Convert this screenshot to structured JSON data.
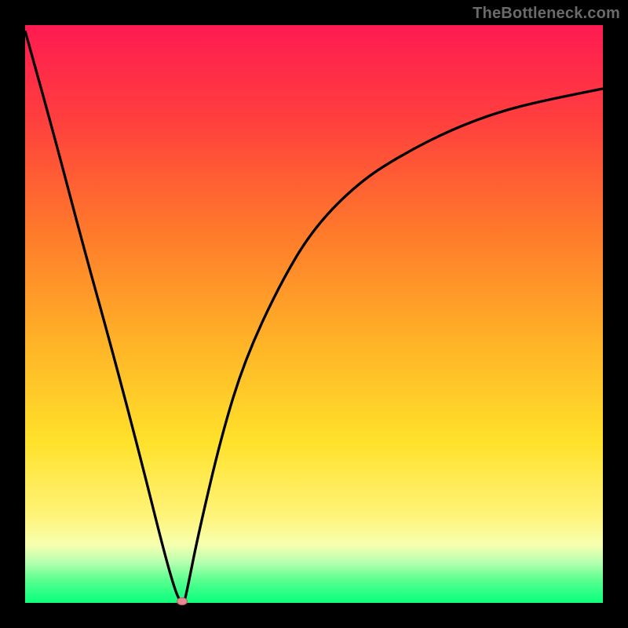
{
  "attribution": "TheBottleneck.com",
  "colors": {
    "curve": "#000000",
    "marker_fill": "#e58a92",
    "marker_stroke": "#b85f68",
    "border": "#000000"
  },
  "chart_data": {
    "type": "line",
    "title": "",
    "xlabel": "",
    "ylabel": "",
    "xlim": [
      0,
      100
    ],
    "ylim": [
      0,
      100
    ],
    "grid": false,
    "legend": false,
    "series": [
      {
        "name": "bottleneck-curve",
        "x": [
          0,
          5,
          10,
          15,
          20,
          24,
          26,
          27,
          27.5,
          28,
          30,
          34,
          38,
          44,
          50,
          58,
          66,
          74,
          82,
          90,
          100
        ],
        "y": [
          99,
          81,
          62,
          44,
          25,
          9,
          2,
          0,
          0,
          2,
          12,
          29,
          42,
          55,
          65,
          73,
          78,
          82,
          85,
          87,
          89
        ]
      }
    ],
    "annotations": [
      {
        "name": "min-marker",
        "x": 27.2,
        "y": 0.3,
        "shape": "ellipse"
      }
    ]
  }
}
